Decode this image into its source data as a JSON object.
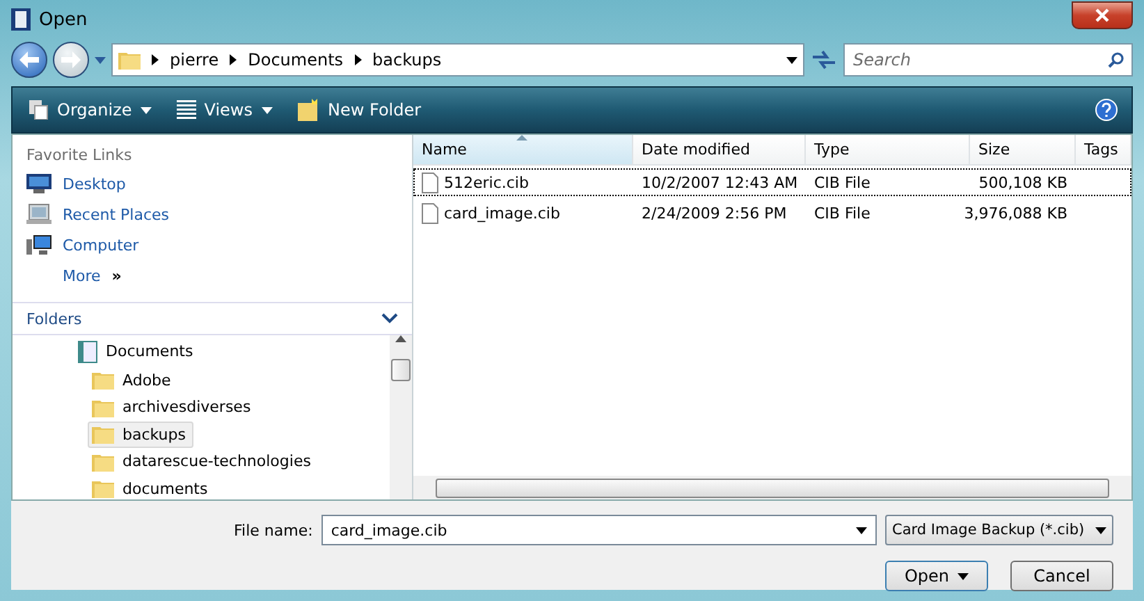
{
  "window": {
    "title": "Open"
  },
  "address": {
    "path": [
      "pierre",
      "Documents",
      "backups"
    ]
  },
  "search": {
    "placeholder": "Search"
  },
  "toolbar": [
    {
      "label": "Organize",
      "kind": "menu"
    },
    {
      "label": "Views",
      "kind": "menu"
    },
    {
      "label": "New Folder",
      "kind": "button"
    }
  ],
  "favorite_links": {
    "title": "Favorite Links",
    "items": [
      {
        "label": "Desktop"
      },
      {
        "label": "Recent Places"
      },
      {
        "label": "Computer"
      }
    ],
    "more": {
      "label": "More",
      "glyph": "»"
    }
  },
  "folders": {
    "title": "Folders",
    "tree": [
      {
        "label": "Documents",
        "selected": false,
        "children": [
          {
            "label": "Adobe",
            "selected": false
          },
          {
            "label": "archivesdiverses",
            "selected": false
          },
          {
            "label": "backups",
            "selected": true
          },
          {
            "label": "datarescue-technologies",
            "selected": false
          },
          {
            "label": "documents",
            "selected": false
          }
        ]
      }
    ]
  },
  "file_list": {
    "columns": [
      {
        "label": "Name",
        "sorted": true
      },
      {
        "label": "Date modified",
        "sorted": false
      },
      {
        "label": "Type",
        "sorted": false
      },
      {
        "label": "Size",
        "sorted": false
      },
      {
        "label": "Tags",
        "sorted": false
      }
    ],
    "rows": [
      {
        "name": "512eric.cib",
        "date": "10/2/2007 12:43 AM",
        "type": "CIB File",
        "size": "500,108 KB",
        "focused": true
      },
      {
        "name": "card_image.cib",
        "date": "2/24/2009 2:56 PM",
        "type": "CIB File",
        "size": "3,976,088 KB",
        "focused": false
      }
    ]
  },
  "file_name": {
    "label": "File name:",
    "value": "card_image.cib"
  },
  "file_type": {
    "value": "Card Image Backup (*.cib)"
  },
  "buttons": [
    {
      "label": "Open",
      "kind": "split"
    },
    {
      "label": "Cancel",
      "kind": "plain"
    }
  ]
}
